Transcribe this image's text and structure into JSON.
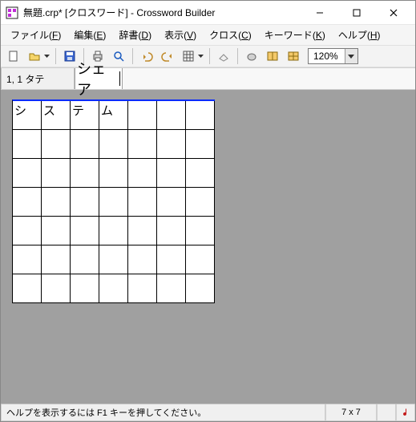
{
  "title": "無題.crp* [クロスワード] - Crossword Builder",
  "menus": {
    "file": {
      "label": "ファイル",
      "key": "F"
    },
    "edit": {
      "label": "編集",
      "key": "E"
    },
    "dict": {
      "label": "辞書",
      "key": "D"
    },
    "view": {
      "label": "表示",
      "key": "V"
    },
    "cross": {
      "label": "クロス",
      "key": "C"
    },
    "kw": {
      "label": "キーワード",
      "key": "K"
    },
    "help": {
      "label": "ヘルプ",
      "key": "H"
    }
  },
  "toolbar": {
    "zoom": "120%"
  },
  "clue": {
    "label": "1, 1 タテ",
    "value": "シェア"
  },
  "grid": {
    "cols": 7,
    "rows": 7,
    "cells": [
      [
        "シ",
        "ス",
        "テ",
        "ム",
        "",
        "",
        ""
      ],
      [
        "",
        "",
        "",
        "",
        "",
        "",
        ""
      ],
      [
        "",
        "",
        "",
        "",
        "",
        "",
        ""
      ],
      [
        "",
        "",
        "",
        "",
        "",
        "",
        ""
      ],
      [
        "",
        "",
        "",
        "",
        "",
        "",
        ""
      ],
      [
        "",
        "",
        "",
        "",
        "",
        "",
        ""
      ],
      [
        "",
        "",
        "",
        "",
        "",
        "",
        ""
      ]
    ]
  },
  "status": {
    "hint": "ヘルプを表示するには F1 キーを押してください。",
    "dims": "7 x 7"
  }
}
